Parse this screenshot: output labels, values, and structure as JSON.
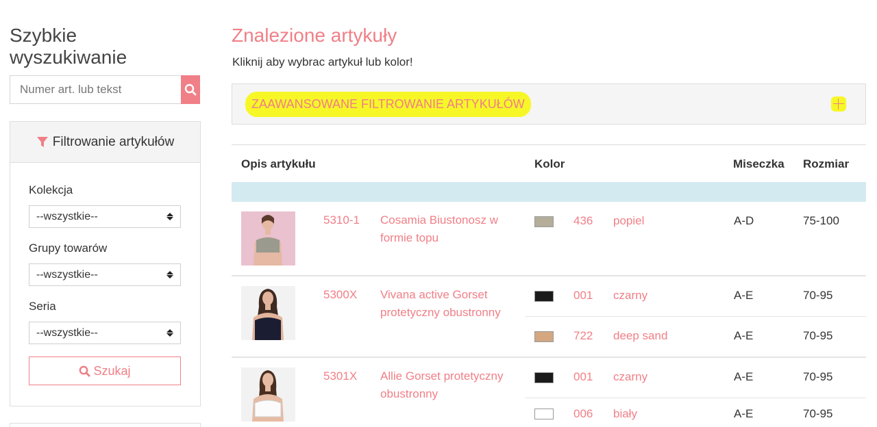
{
  "sidebar": {
    "title": "Szybkie wyszukiwanie",
    "search_placeholder": "Numer art. lub tekst",
    "filter_title": "Filtrowanie artykułów",
    "collection_label": "Kolekcja",
    "collection_value": "--wszystkie--",
    "groups_label": "Grupy towarów",
    "groups_value": "--wszystkie--",
    "series_label": "Seria",
    "series_value": "--wszystkie--",
    "search_button": "Szukaj"
  },
  "main": {
    "title": "Znalezione artykuły",
    "subtitle": "Kliknij aby wybrac artykuł lub kolor!",
    "advanced_filter": "ZAAWANSOWANE FILTROWANIE ARTYKUŁÓW",
    "columns": [
      "Opis artykułu",
      "Kolor",
      "Miseczka",
      "Rozmiar"
    ]
  },
  "articles": [
    {
      "number": "5310-1",
      "description": "Cosamia Biustonosz w formie topu",
      "variants": [
        {
          "code": "436",
          "color": "popiel",
          "swatch": "#b3ad9a",
          "cup": "A-D",
          "size": "75-100"
        }
      ]
    },
    {
      "number": "5300X",
      "description": "Vivana active Gorset protetyczny obustronny",
      "variants": [
        {
          "code": "001",
          "color": "czarny",
          "swatch": "#1a1a1a",
          "cup": "A-E",
          "size": "70-95"
        },
        {
          "code": "722",
          "color": "deep sand",
          "swatch": "#d4a781",
          "cup": "A-E",
          "size": "70-95"
        }
      ]
    },
    {
      "number": "5301X",
      "description": "Allie Gorset protetyczny obustronny",
      "variants": [
        {
          "code": "001",
          "color": "czarny",
          "swatch": "#1a1a1a",
          "cup": "A-E",
          "size": "70-95"
        },
        {
          "code": "006",
          "color": "biały",
          "swatch": "#ffffff",
          "cup": "A-E",
          "size": "70-95"
        }
      ]
    }
  ],
  "colors": {
    "accent": "#f07f87",
    "highlight": "#f7f728",
    "band": "#d3eaf0"
  },
  "icons": [
    "search-icon",
    "filter-icon",
    "plus-icon",
    "sort-arrows-icon"
  ]
}
